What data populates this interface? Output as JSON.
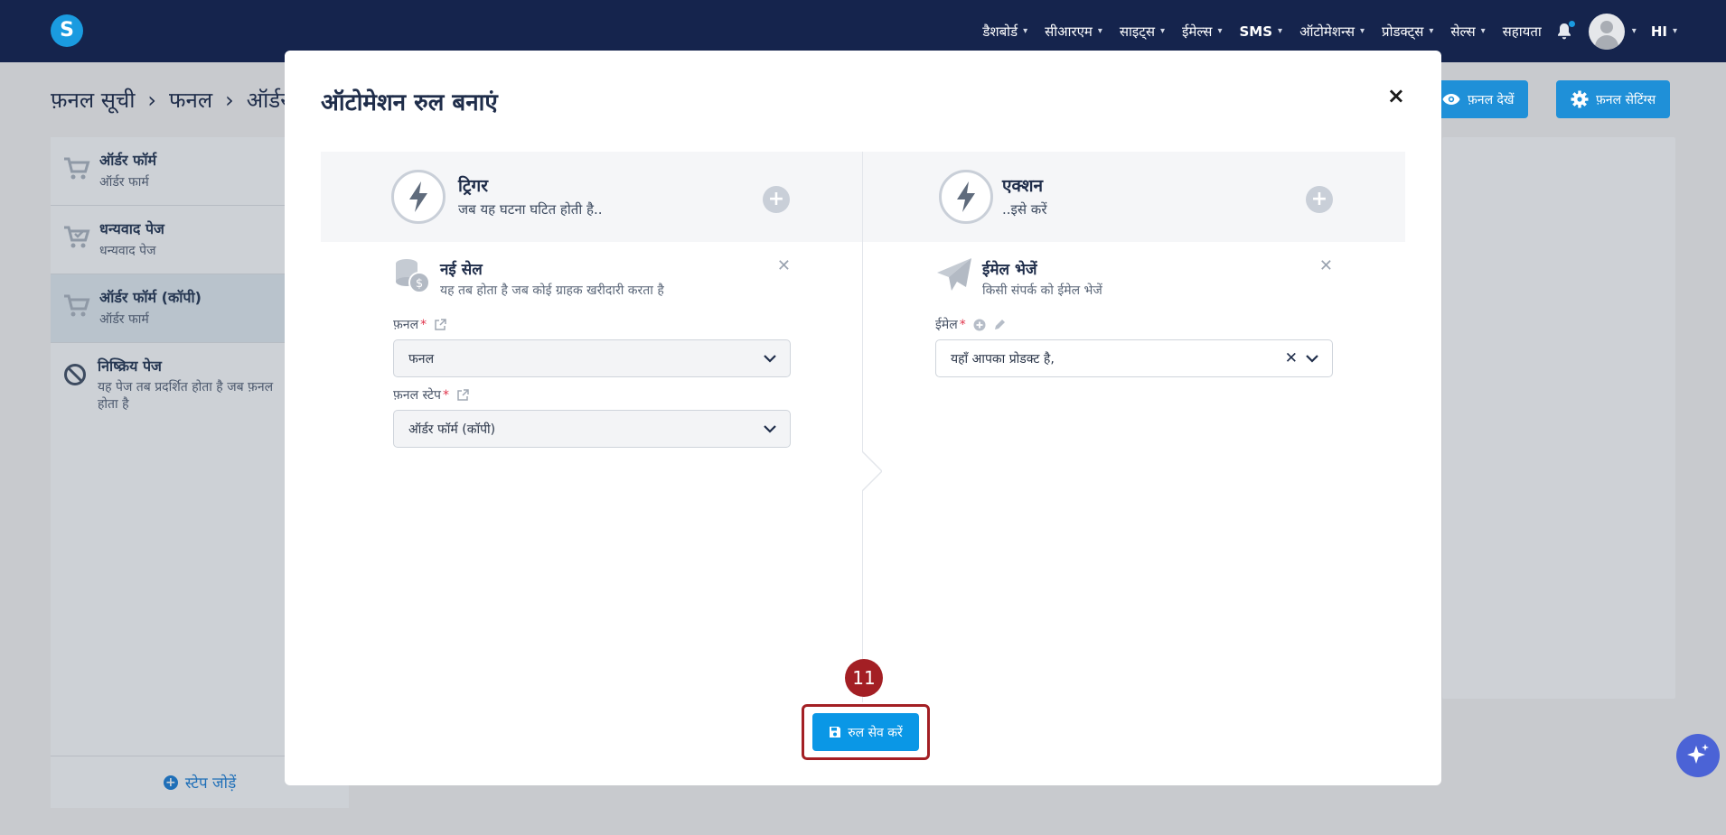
{
  "nav": {
    "logo": "S",
    "items": [
      "डैशबोर्ड",
      "सीआरएम",
      "साइट्स",
      "ईमेल्स",
      "SMS",
      "ऑटोमेशन्स",
      "प्रोडक्ट्स",
      "सेल्स"
    ],
    "help": "सहायता",
    "user_label": "HI"
  },
  "page": {
    "breadcrumb": [
      "फ़नल सूची",
      "फनल",
      "ऑर्डर"
    ],
    "view_funnel_label": "फ़नल देखें",
    "funnel_settings_label": "फ़नल सेटिंग्स",
    "steps": [
      {
        "title": "ऑर्डर फॉर्म",
        "subtitle": "ऑर्डर फार्म"
      },
      {
        "title": "धन्यवाद पेज",
        "subtitle": "धन्यवाद पेज"
      },
      {
        "title": "ऑर्डर फॉर्म (कॉपी)",
        "subtitle": "ऑर्डर फार्म"
      }
    ],
    "inactive_step": {
      "title": "निष्क्रिय पेज",
      "subtitle": "यह पेज तब प्रदर्शित होता है जब फ़नल होता है"
    },
    "add_step_label": "स्टेप जोड़ें"
  },
  "modal": {
    "title": "ऑटोमेशन रुल बनाएं",
    "close": "×",
    "trigger": {
      "heading": "ट्रिगर",
      "subheading": "जब यह घटना घटित होती है..",
      "card_title": "नई सेल",
      "card_desc": "यह तब होता है जब कोई ग्राहक खरीदारी करता है",
      "funnel_label": "फ़नल",
      "funnel_value": "फनल",
      "funnel_step_label": "फ़नल स्टेप",
      "funnel_step_value": "ऑर्डर फॉर्म (कॉपी)"
    },
    "action": {
      "heading": "एक्शन",
      "subheading": "..इसे करें",
      "card_title": "ईमेल भेजें",
      "card_desc": "किसी संपर्क को ईमेल भेजें",
      "email_label": "ईमेल",
      "email_value": "यहाँ आपका प्रोडक्ट है,"
    },
    "save_label": "रुल सेव करें",
    "step_badge": "11"
  },
  "colors": {
    "nav_bg": "#15244d",
    "primary": "#0a97e6",
    "highlight": "#a31f24",
    "overlay": "#c8cace"
  }
}
